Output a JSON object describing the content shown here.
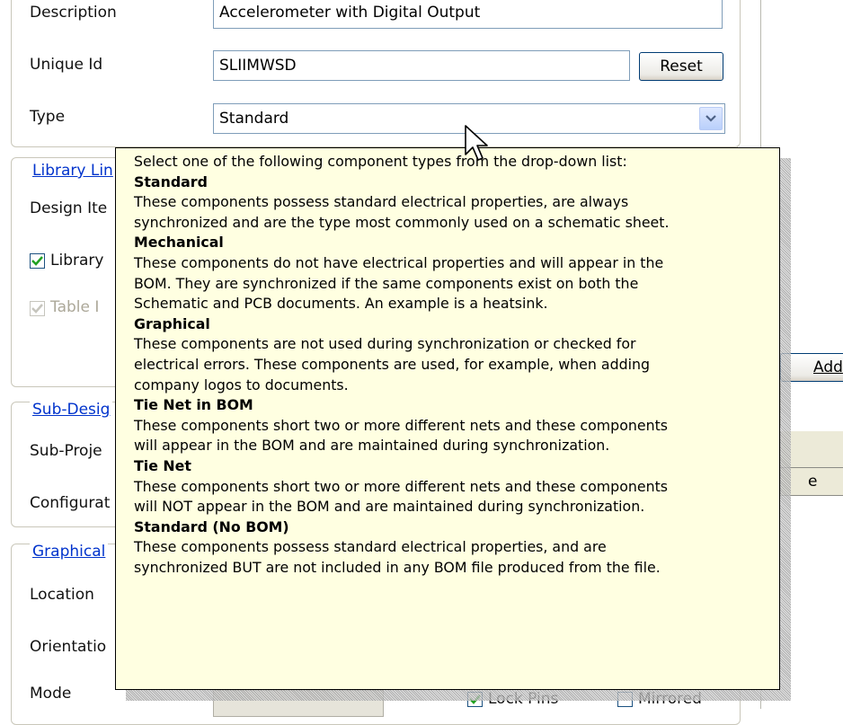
{
  "form": {
    "description_label": "Description",
    "description_value": "Accelerometer with Digital Output",
    "unique_id_label": "Unique Id",
    "unique_id_value": "SLIIMWSD",
    "reset_button": "Reset",
    "type_label": "Type",
    "type_value": "Standard"
  },
  "sections": {
    "library_link": "Library Lin",
    "design_item_label": "Design Ite",
    "library_checkbox_label": "Library",
    "table_checkbox_label": "Table I",
    "sub_design": "Sub-Desig",
    "sub_project_label": "Sub-Proje",
    "configuration_label": "Configurat",
    "graphical": "Graphical",
    "location_label": "Location",
    "orientation_label": "Orientatio",
    "mode_label": "Mode"
  },
  "right_panel": {
    "add_button_partial": "Add",
    "column_partial": "e"
  },
  "bottom": {
    "lock_pins_partial": "Lock Pins",
    "mirrored_partial": "Mirrored"
  },
  "tooltip": {
    "intro": "Select one of the following component types from the drop-down list:",
    "entries": [
      {
        "title": "Standard",
        "lines": [
          "These components possess standard electrical properties, are always",
          "synchronized and are the type most commonly used on a schematic sheet."
        ]
      },
      {
        "title": "Mechanical",
        "lines": [
          "These components do not have electrical properties and will appear in the",
          "BOM. They are synchronized if the same components exist on both the",
          "Schematic and PCB documents. An example is a heatsink."
        ]
      },
      {
        "title": "Graphical",
        "lines": [
          "These components are not used during synchronization or checked for",
          "electrical errors. These components are used, for example, when adding",
          "company logos to documents."
        ]
      },
      {
        "title": "Tie Net in BOM",
        "lines": [
          "These components short two or more different nets and these components",
          "will appear in the BOM and are maintained during synchronization."
        ]
      },
      {
        "title": "Tie Net",
        "lines": [
          "These components short two or more different nets and these components",
          "will NOT appear in the BOM and are maintained during synchronization."
        ]
      },
      {
        "title": "Standard (No BOM)",
        "lines": [
          "These components possess standard electrical properties, and are",
          "synchronized BUT are not included in any BOM file produced from the file."
        ]
      }
    ]
  },
  "icons": {
    "dropdown": "chevron-down-icon",
    "cursor": "mouse-pointer-icon",
    "check": "check-icon"
  }
}
